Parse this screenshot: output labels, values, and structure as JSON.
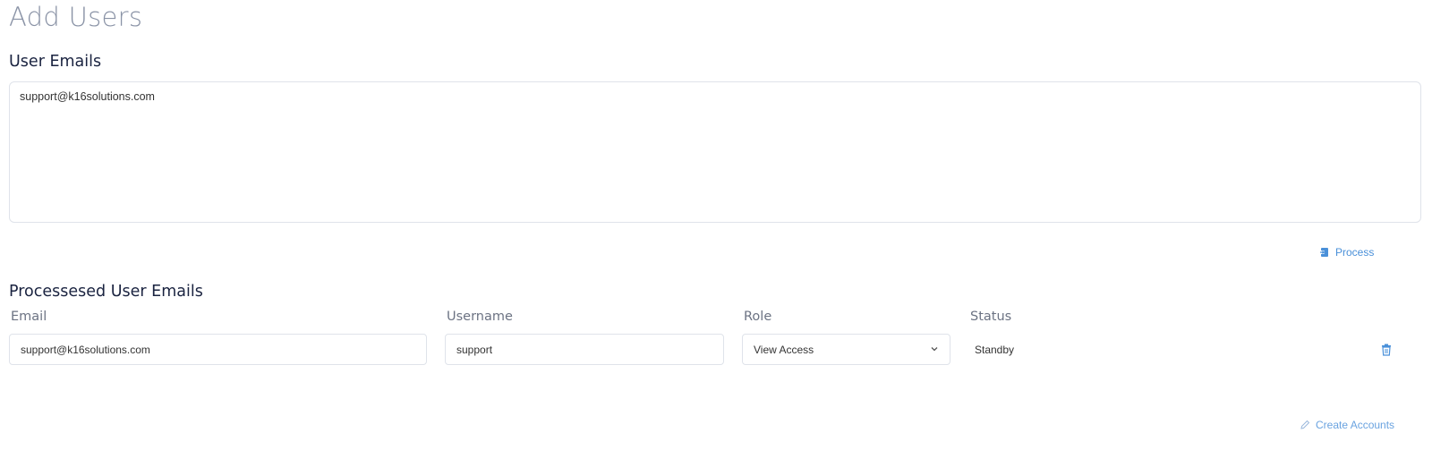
{
  "page": {
    "title": "Add Users"
  },
  "user_emails": {
    "heading": "User Emails",
    "value": "support@k16solutions.com",
    "process_label": "Process"
  },
  "processed": {
    "heading": "Processesed User Emails",
    "columns": {
      "email": "Email",
      "username": "Username",
      "role": "Role",
      "status": "Status"
    },
    "rows": [
      {
        "email": "support@k16solutions.com",
        "username": "support",
        "role": "View Access",
        "status": "Standby"
      }
    ]
  },
  "actions": {
    "create_label": "Create Accounts"
  },
  "icons": {
    "process": "process-icon",
    "delete": "trash-icon",
    "create": "pencil-icon",
    "dropdown": "chevron-down-icon"
  },
  "colors": {
    "link": "#4a90d9",
    "heading": "#1a2340",
    "muted": "#6c7383"
  }
}
